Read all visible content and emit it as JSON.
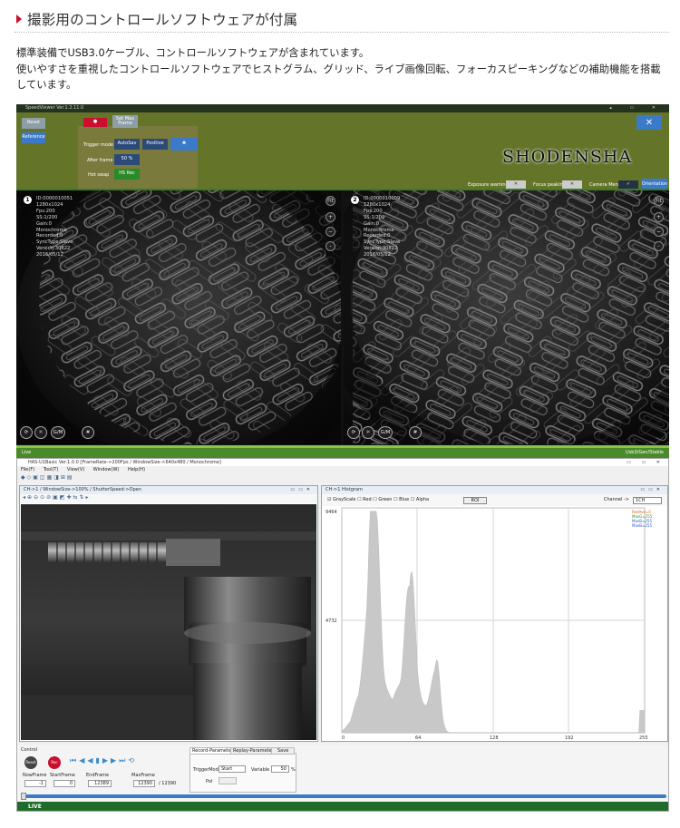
{
  "heading": "撮影用のコントロールソフトウェアが付属",
  "description_line1": "標準装備でUSB3.0ケーブル、コントロールソフトウェアが含まれています。",
  "description_line2": "使いやすさを重視したコントロールソフトウェアでヒストグラム、グリッド、ライブ画像回転、フォーカスピーキングなどの補助機能を搭載しています。",
  "speedviewer": {
    "title": "SpeedViewer Ver.1.2.11.0",
    "reset": "Reset",
    "reference": "Reference",
    "set_max_frame": "Set Max Frame",
    "trigger_mode_label": "Trigger mode",
    "trigger_mode_value": "AutoSav",
    "trigger_polarity": "Positive",
    "after_frame_label": "After frame",
    "after_frame_value": "50 %",
    "hot_swap_label": "Hot swap",
    "hot_swap_value": "HS Rec",
    "brand": "SHODENSHA",
    "exposure_warning": "Exposure warning",
    "focus_peaking": "Focus peaking",
    "camera_menu": "Camera Menu",
    "orientation": "Orientation",
    "fit": "Fit",
    "status_left": "Live",
    "status_right": "Usb3/Gen/Stable",
    "cam1": {
      "num": "1",
      "info": [
        "ID:0000010051",
        "1280x1024",
        "Fps:200",
        "SS:1/200",
        "Gain:0",
        "Monochrome",
        "Recorded:0",
        "SyncType:Slave",
        "Version:30822",
        "2016/05/12"
      ]
    },
    "cam2": {
      "num": "2",
      "info": [
        "ID:0000010009",
        "1280x1024",
        "Fps:200",
        "SS:1/200",
        "Gain:0",
        "Monochrome",
        "Recorded:0",
        "SyncType:Slave",
        "Version:30822",
        "2016/05/12"
      ]
    },
    "gm": "G/M"
  },
  "has": {
    "title": "HAS-U1Basic Ver.1.0.0   [FrameRate->200Fps / WindowSize->640x480 / Monochrome]",
    "menu": [
      "File(F)",
      "Tool(T)",
      "View(V)",
      "Window(W)",
      "Help(H)"
    ],
    "video_title": "CH->1 / WindowSize->100% / ShutterSpeed->Open",
    "hist_title": "CH->1 Histgram",
    "grayscale": "GrayScale",
    "red": "Red",
    "green": "Green",
    "blue": "Blue",
    "alpha": "Alpha",
    "roi": "ROI",
    "channel_label": "Channel ->",
    "channel_value": "1CH",
    "hist_ymax": "9464",
    "hist_ymid": "4732",
    "hist_xticks": [
      "0",
      "64",
      "128",
      "192",
      "255"
    ],
    "hist_legend": [
      "RedAve=0",
      "MaxG=255",
      "MaxB=255",
      "MaxB=255"
    ],
    "control_label": "Control",
    "reset": "Reset",
    "rec": "Rec",
    "now_frame_label": "NowFrame",
    "now_frame": "-1",
    "start_frame_label": "StartFrame",
    "start_frame": "0",
    "end_frame_label": "EndFrame",
    "end_frame": "12389",
    "max_frame_label": "MaxFrame",
    "max_frame": "12390",
    "max_frame_total": "/ 12390",
    "tabs": [
      "Record-Parameter",
      "Replay-Parameter",
      "Save"
    ],
    "trigger_mode_label": "TriggerMode",
    "trigger_mode": "Start",
    "variable_label": "Variable",
    "variable_value": "50",
    "variable_unit": "%",
    "pol_label": "Pol",
    "live": "LIVE"
  },
  "colors": {
    "accent_red": "#c8102e",
    "sv_green": "#64752a",
    "live_green": "#1f6b2a"
  }
}
